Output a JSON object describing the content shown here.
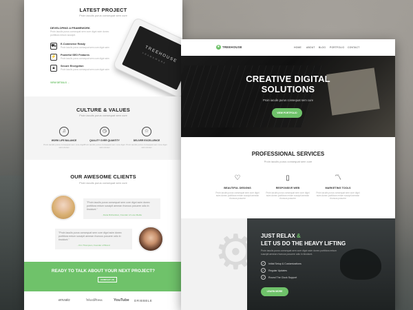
{
  "left_page": {
    "latest_project": {
      "title": "LATEST PROJECT",
      "subtitle": "Proin iaculis purus consequat sem cure",
      "project_heading": "DEVELOPING A FRAMEWORK",
      "project_desc": "Proin iaculis purus consequat sem cure digni ssim donec porttitora entum suscipit.",
      "features": [
        {
          "icon": "cart-icon",
          "title": "E-Commerce Ready",
          "desc": "Proin iaculis purus consequat sem cure digni ssim"
        },
        {
          "icon": "bolt-icon",
          "title": "Powerful SEO Features",
          "desc": "Proin iaculis purus consequat sem cure digni ssim"
        },
        {
          "icon": "lock-icon",
          "title": "Secure Encryption",
          "desc": "Proin iaculis purus consequat sem cure digni ssim"
        }
      ],
      "view_details": "VIEW DETAILS →",
      "tablet_logo": "TREEHOUSE",
      "tablet_tagline": "FRAMEWORK"
    },
    "culture": {
      "title": "CULTURE & VALUES",
      "subtitle": "Proin iaculis purus consequat sem cure",
      "values": [
        {
          "icon": "music-icon",
          "title": "WORK LIFE BALANCE",
          "desc": "Proin iaculis purus consequat sem cure digni ssim donec"
        },
        {
          "icon": "clock-icon",
          "title": "QUALITY OVER QUANTITY",
          "desc": "Proin iaculis purus consequat sem cure digni ssim donec"
        },
        {
          "icon": "star-icon",
          "title": "DELIVER EXCELLENCE",
          "desc": "Proin iaculis purus consequat sem cure digni ssim donec"
        }
      ]
    },
    "clients": {
      "title": "OUR AWESOME CLIENTS",
      "subtitle": "Proin iaculis purus consequat sem cure",
      "testimonials": [
        {
          "text": "\"Proin iaculis purus consequat sem cure digni ssim donec porttitora entum suscipit aenean rhoncus posuere odio in tincidunt.\"",
          "author": "- Dana Richardson, Founder of Luxe Media"
        },
        {
          "text": "\"Proin iaculis purus consequat sem cure digni ssim donec porttitora entum suscipit aenean rhoncus posuere odio in tincidunt.\"",
          "author": "- Kim Thompson, Founder of Brand"
        }
      ]
    },
    "cta": {
      "title": "READY TO TALK ABOUT YOUR NEXT PROJECT?",
      "button": "CONTACT US"
    },
    "logos": [
      "envato",
      "WordPress",
      "YouTube",
      "DRIBBBLE"
    ]
  },
  "right_page": {
    "brand": "TREEHOUSE",
    "nav": [
      "HOME",
      "ABOUT",
      "BLOG",
      "PORTFOLIO",
      "CONTACT"
    ],
    "hero": {
      "title_line1": "CREATIVE DIGITAL",
      "title_line2": "SOLUTIONS",
      "subtitle": "Proin iaculis purus consequat sem cure",
      "button": "VIEW PORTFOLIO"
    },
    "services": {
      "title": "PROFESSIONAL SERVICES",
      "subtitle": "Proin iaculis purus consequat sem cure",
      "items": [
        {
          "icon": "heart-icon",
          "title": "BEAUTIFUL DESIGNS",
          "desc": "Proin iaculis purus consequat sem cure digni ssim donec porttitora entum suscipit aenean rhoncus posuere"
        },
        {
          "icon": "tablet-icon",
          "title": "RESPONSIVE WEB",
          "desc": "Proin iaculis purus consequat sem cure digni ssim donec porttitora entum suscipit aenean rhoncus posuere"
        },
        {
          "icon": "chart-line-icon",
          "title": "MARKETING TOOLS",
          "desc": "Proin iaculis purus consequat sem cure digni ssim donec porttitora entum suscipit aenean rhoncus posuere"
        }
      ]
    },
    "relax": {
      "title_part1": "JUST RELAX",
      "title_amp": "&",
      "title_line2": "LET US DO THE HEAVY LIFTING",
      "desc": "Proin iaculis purus consequat sem cure digni ssim donec porttitora entum suscipit aenean rhoncus posuere odio in tincidunt.",
      "list": [
        "Initial Setup & Customizations",
        "Regular Updates",
        "Round The Clock Support"
      ],
      "button": "LEARN MORE"
    }
  },
  "colors": {
    "accent": "#6fc26a",
    "dark_panel": "#2a2e2f",
    "light_bg": "#f4f4f4"
  }
}
